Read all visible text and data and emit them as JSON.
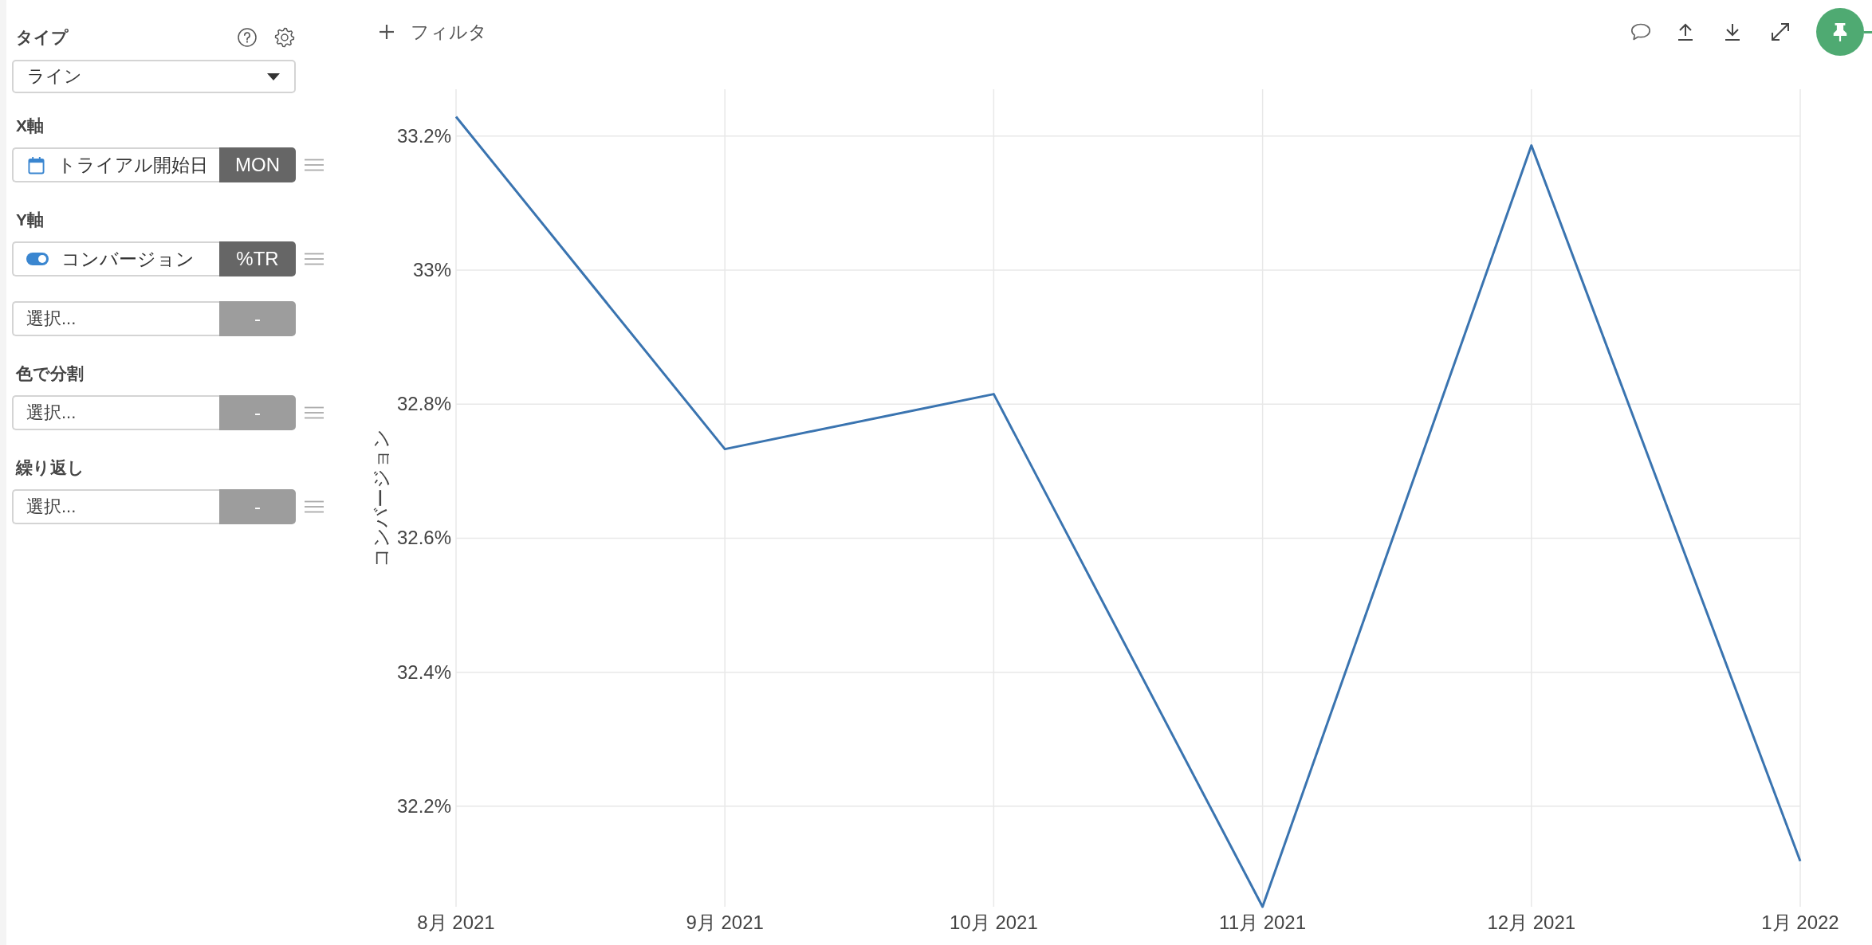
{
  "sidebar": {
    "type_label": "タイプ",
    "chart_type": {
      "value": "ライン"
    },
    "sections": [
      {
        "label": "X軸",
        "fields": [
          {
            "kind": "date",
            "value": "トライアル開始日",
            "tag": {
              "label": "MON",
              "disabled": false
            },
            "draggable": true
          }
        ]
      },
      {
        "label": "Y軸",
        "fields": [
          {
            "kind": "toggle",
            "on": true,
            "value": "コンバージョン",
            "tag": {
              "label": "%TR",
              "disabled": false
            },
            "draggable": true
          },
          {
            "kind": "empty",
            "placeholder": "選択...",
            "tag": {
              "label": "-",
              "disabled": true
            },
            "draggable": false
          }
        ]
      },
      {
        "label": "色で分割",
        "fields": [
          {
            "kind": "empty",
            "placeholder": "選択...",
            "tag": {
              "label": "-",
              "disabled": true
            },
            "draggable": true
          }
        ]
      },
      {
        "label": "繰り返し",
        "fields": [
          {
            "kind": "empty",
            "placeholder": "選択...",
            "tag": {
              "label": "-",
              "disabled": true
            },
            "draggable": true
          }
        ]
      }
    ]
  },
  "toolbar": {
    "filter_label": "フィルタ"
  },
  "chart": {
    "chart_data": {
      "type": "line",
      "ylabel": "コンバージョン",
      "grid": true,
      "categories": [
        "8月 2021",
        "9月 2021",
        "10月 2021",
        "11月 2021",
        "12月 2021",
        "1月 2022"
      ],
      "ylim": [
        32.05,
        33.27
      ],
      "yticks": [
        {
          "value": 32.2,
          "label": "32.2%"
        },
        {
          "value": 32.4,
          "label": "32.4%"
        },
        {
          "value": 32.6,
          "label": "32.6%"
        },
        {
          "value": 32.8,
          "label": "32.8%"
        },
        {
          "value": 33,
          "label": "33%"
        },
        {
          "value": 33.2,
          "label": "33.2%"
        }
      ],
      "series": [
        {
          "color": "#3a74b0",
          "values": [
            33.229,
            32.733,
            32.815,
            32.05,
            33.186,
            32.118
          ]
        }
      ]
    }
  }
}
